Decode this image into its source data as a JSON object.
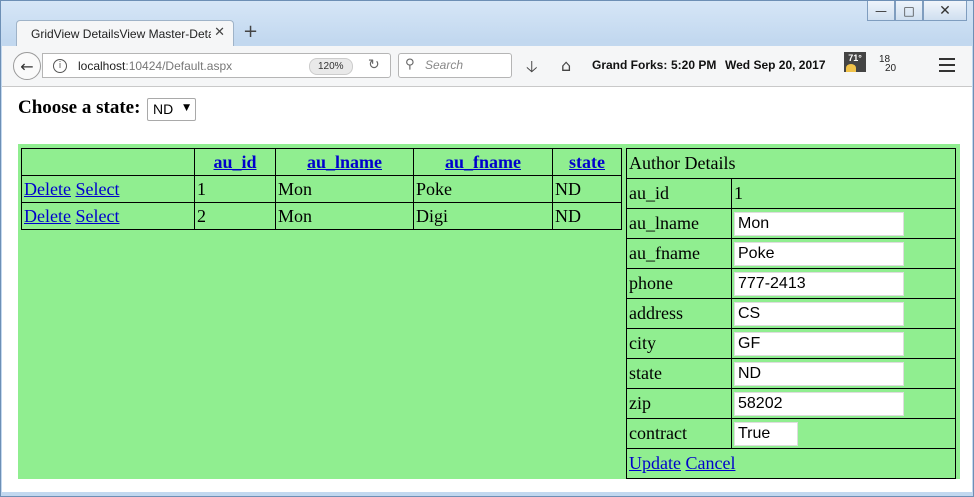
{
  "browser": {
    "tab_title": "GridView DetailsView Master-Deta",
    "url_host": "localhost",
    "url_rest": ":10424/Default.aspx",
    "zoom": "120%",
    "search_placeholder": "Search",
    "weather_city": "Grand Forks:",
    "weather_time": "5:20 PM",
    "weather_date": "Wed Sep 20, 2017",
    "temp": "71°",
    "temp_high": "18",
    "temp_low": "20"
  },
  "page": {
    "state_label": "Choose a state:",
    "state_selected": "ND"
  },
  "grid": {
    "headers": [
      "",
      "au_id",
      "au_lname",
      "au_fname",
      "state"
    ],
    "rows": [
      {
        "delete": "Delete",
        "select": "Select",
        "au_id": "1",
        "au_lname": "Mon",
        "au_fname": "Poke",
        "state": "ND"
      },
      {
        "delete": "Delete",
        "select": "Select",
        "au_id": "2",
        "au_lname": "Mon",
        "au_fname": "Digi",
        "state": "ND"
      }
    ]
  },
  "details": {
    "header": "Author Details",
    "fields": [
      {
        "label": "au_id",
        "value": "1"
      },
      {
        "label": "au_lname",
        "value": "Mon"
      },
      {
        "label": "au_fname",
        "value": "Poke"
      },
      {
        "label": "phone",
        "value": "777-2413"
      },
      {
        "label": "address",
        "value": "CS"
      },
      {
        "label": "city",
        "value": "GF"
      },
      {
        "label": "state",
        "value": "ND"
      },
      {
        "label": "zip",
        "value": "58202"
      },
      {
        "label": "contract",
        "value": "True"
      }
    ],
    "update_label": "Update",
    "cancel_label": "Cancel"
  },
  "colors": {
    "panel_bg": "#90ee90",
    "link": "#0000cc"
  }
}
